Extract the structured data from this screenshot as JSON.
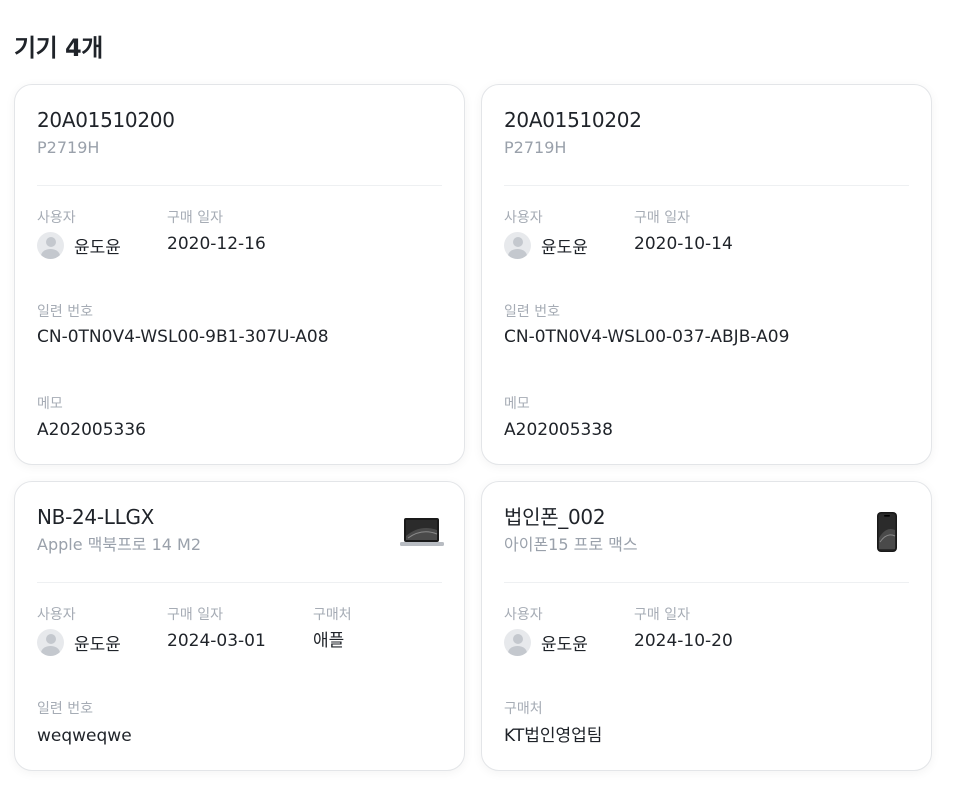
{
  "page": {
    "title": "기기 4개"
  },
  "labels": {
    "user": "사용자",
    "purchase_date": "구매 일자",
    "vendor": "구매처",
    "serial": "일련 번호",
    "memo": "메모"
  },
  "devices": [
    {
      "name": "20A01510200",
      "model": "P2719H",
      "user": "윤도윤",
      "purchase_date": "2020-12-16",
      "serial": "CN-0TN0V4-WSL00-9B1-307U-A08",
      "memo": "A202005336"
    },
    {
      "name": "20A01510202",
      "model": "P2719H",
      "user": "윤도윤",
      "purchase_date": "2020-10-14",
      "serial": "CN-0TN0V4-WSL00-037-ABJB-A09",
      "memo": "A202005338"
    },
    {
      "name": "NB-24-LLGX",
      "model": "Apple 맥북프로 14 M2",
      "image": "laptop-image",
      "user": "윤도윤",
      "purchase_date": "2024-03-01",
      "vendor": "애플",
      "serial": "weqweqwe"
    },
    {
      "name": "법인폰_002",
      "model": "아이폰15 프로 맥스",
      "image": "phone-image",
      "user": "윤도윤",
      "purchase_date": "2024-10-20",
      "vendor": "KT법인영업팀"
    }
  ]
}
